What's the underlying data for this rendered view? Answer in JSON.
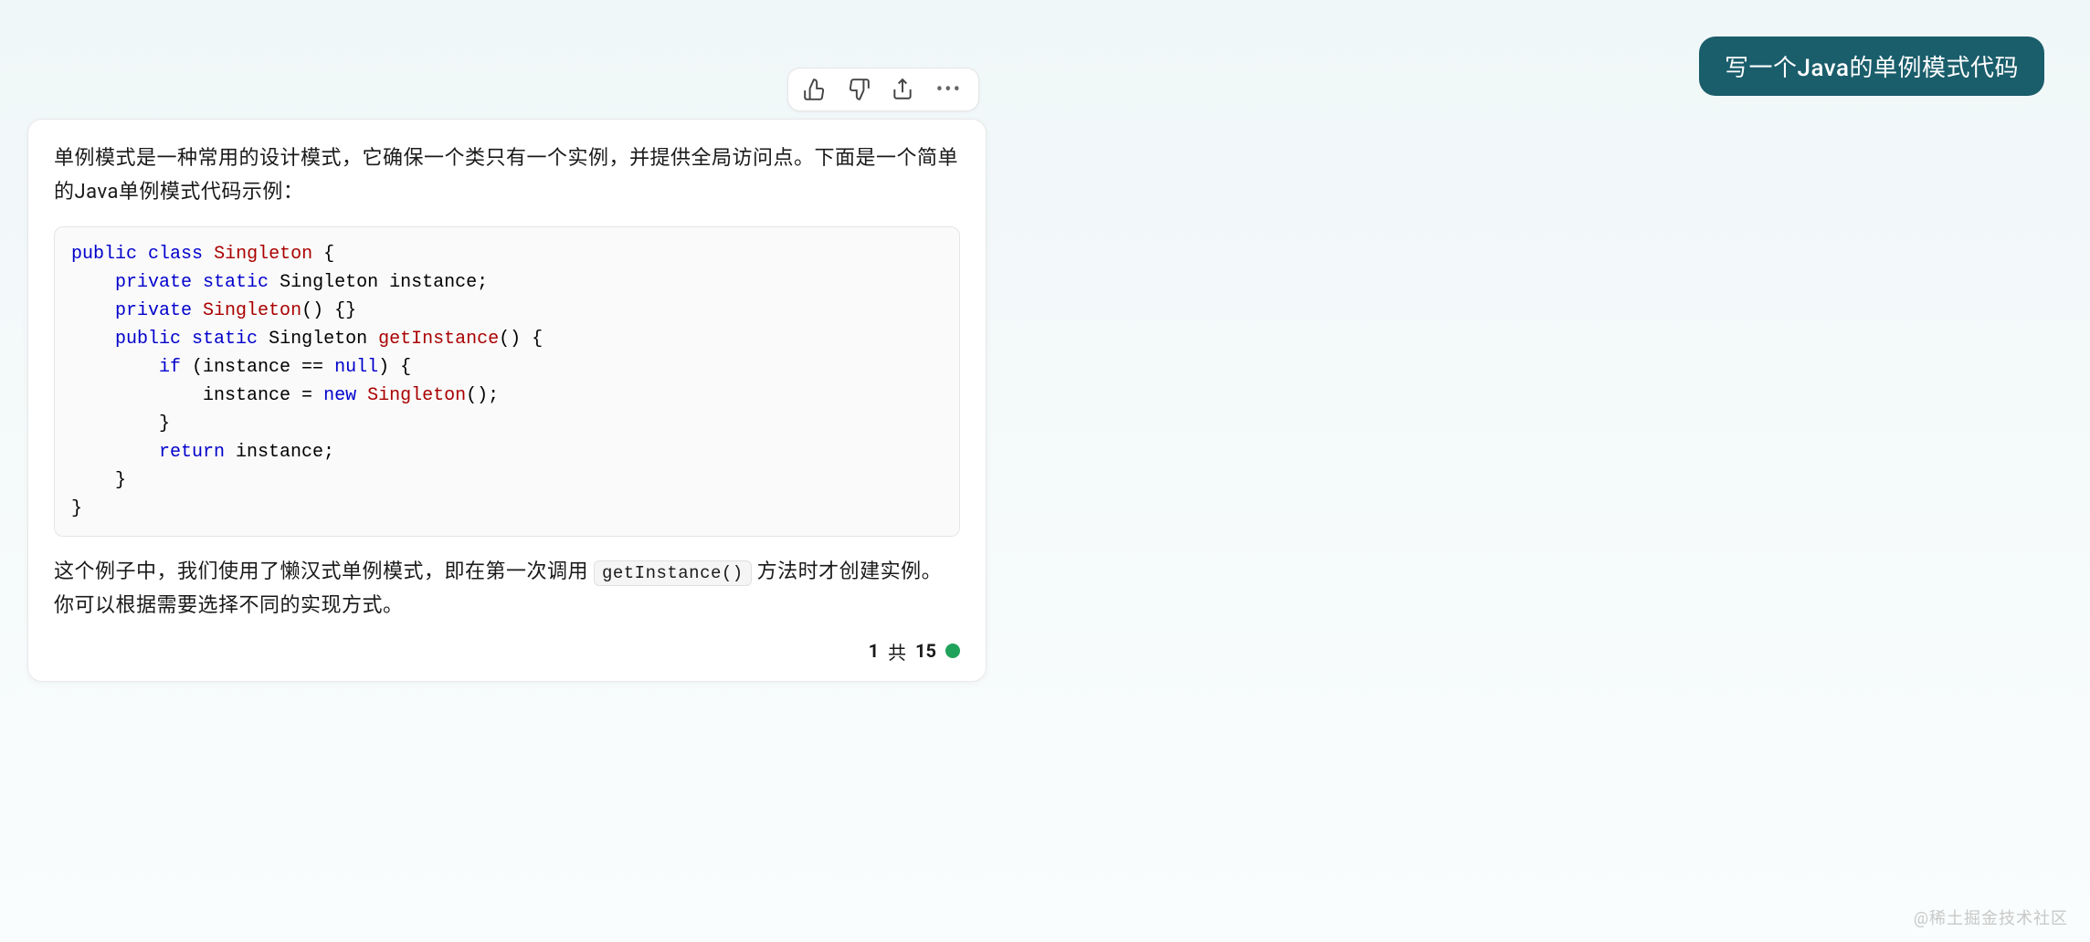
{
  "user_message": "写一个Java的单例模式代码",
  "response": {
    "intro": "单例模式是一种常用的设计模式，它确保一个类只有一个实例，并提供全局访问点。下面是一个简单的Java单例模式代码示例：",
    "code": {
      "l1_kw1": "public",
      "l1_kw2": "class",
      "l1_cls": "Singleton",
      "l1_tail": " {",
      "l2_indent": "    ",
      "l2_kw1": "private",
      "l2_kw2": "static",
      "l2_tail": " Singleton instance;",
      "l3_indent": "    ",
      "l3_kw1": "private",
      "l3_cls": "Singleton",
      "l3_tail": "() {}",
      "l4_indent": "    ",
      "l4_kw1": "public",
      "l4_kw2": "static",
      "l4_mid": " Singleton ",
      "l4_mtd": "getInstance",
      "l4_tail": "() {",
      "l5_indent": "        ",
      "l5_kw": "if",
      "l5_mid": " (instance == ",
      "l5_null": "null",
      "l5_tail": ") {",
      "l6_indent": "            ",
      "l6_mid": "instance = ",
      "l6_kw": "new",
      "l6_sp": " ",
      "l6_cls": "Singleton",
      "l6_tail": "();",
      "l7": "        }",
      "l8_indent": "        ",
      "l8_kw": "return",
      "l8_tail": " instance;",
      "l9": "    }",
      "l10": "}"
    },
    "outro_before": "这个例子中，我们使用了懒汉式单例模式，即在第一次调用 ",
    "outro_inline_code": "getInstance()",
    "outro_after": " 方法时才创建实例。你可以根据需要选择不同的实现方式。"
  },
  "pagination": {
    "current": "1",
    "of_label": "共",
    "total": "15"
  },
  "watermark": "@稀土掘金技术社区"
}
